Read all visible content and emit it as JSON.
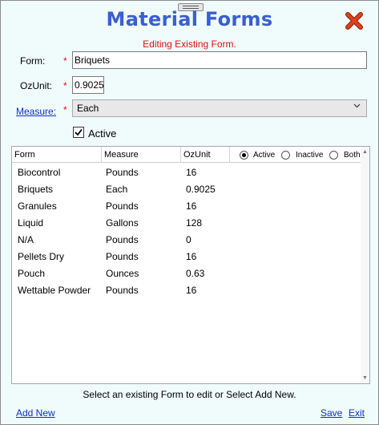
{
  "window": {
    "title": "Material Forms"
  },
  "status": {
    "editing": "Editing Existing Form."
  },
  "form": {
    "form_label": "Form:",
    "form_value": "Briquets",
    "ozunit_label": "OzUnit:",
    "ozunit_value": "0.9025",
    "measure_label": "Measure:",
    "measure_value": "Each",
    "required_mark": "*",
    "active_label": "Active",
    "active_checked": true
  },
  "grid": {
    "columns": [
      "Form",
      "Measure",
      "OzUnit"
    ],
    "filter": {
      "options": [
        "Active",
        "Inactive",
        "Both"
      ],
      "selected": "Active"
    },
    "rows": [
      {
        "form": "Biocontrol",
        "measure": "Pounds",
        "ozunit": "16"
      },
      {
        "form": "Briquets",
        "measure": "Each",
        "ozunit": "0.9025"
      },
      {
        "form": "Granules",
        "measure": "Pounds",
        "ozunit": "16"
      },
      {
        "form": "Liquid",
        "measure": "Gallons",
        "ozunit": "128"
      },
      {
        "form": "N/A",
        "measure": "Pounds",
        "ozunit": "0"
      },
      {
        "form": "Pellets Dry",
        "measure": "Pounds",
        "ozunit": "16"
      },
      {
        "form": "Pouch",
        "measure": "Ounces",
        "ozunit": "0.63"
      },
      {
        "form": "Wettable Powder",
        "measure": "Pounds",
        "ozunit": "16"
      }
    ]
  },
  "footer": {
    "hint": "Select an existing Form to edit or Select Add New.",
    "add_new": "Add New",
    "save": "Save",
    "exit": "Exit"
  },
  "colors": {
    "title": "#3a5fcf",
    "required": "#e01010",
    "link": "#0b2fcc",
    "close": "#e0401a",
    "background": "#f0fbfb"
  },
  "icons": {
    "close": "close-x-icon",
    "checkbox": "check-icon",
    "dropdown": "chevron-down-icon"
  }
}
